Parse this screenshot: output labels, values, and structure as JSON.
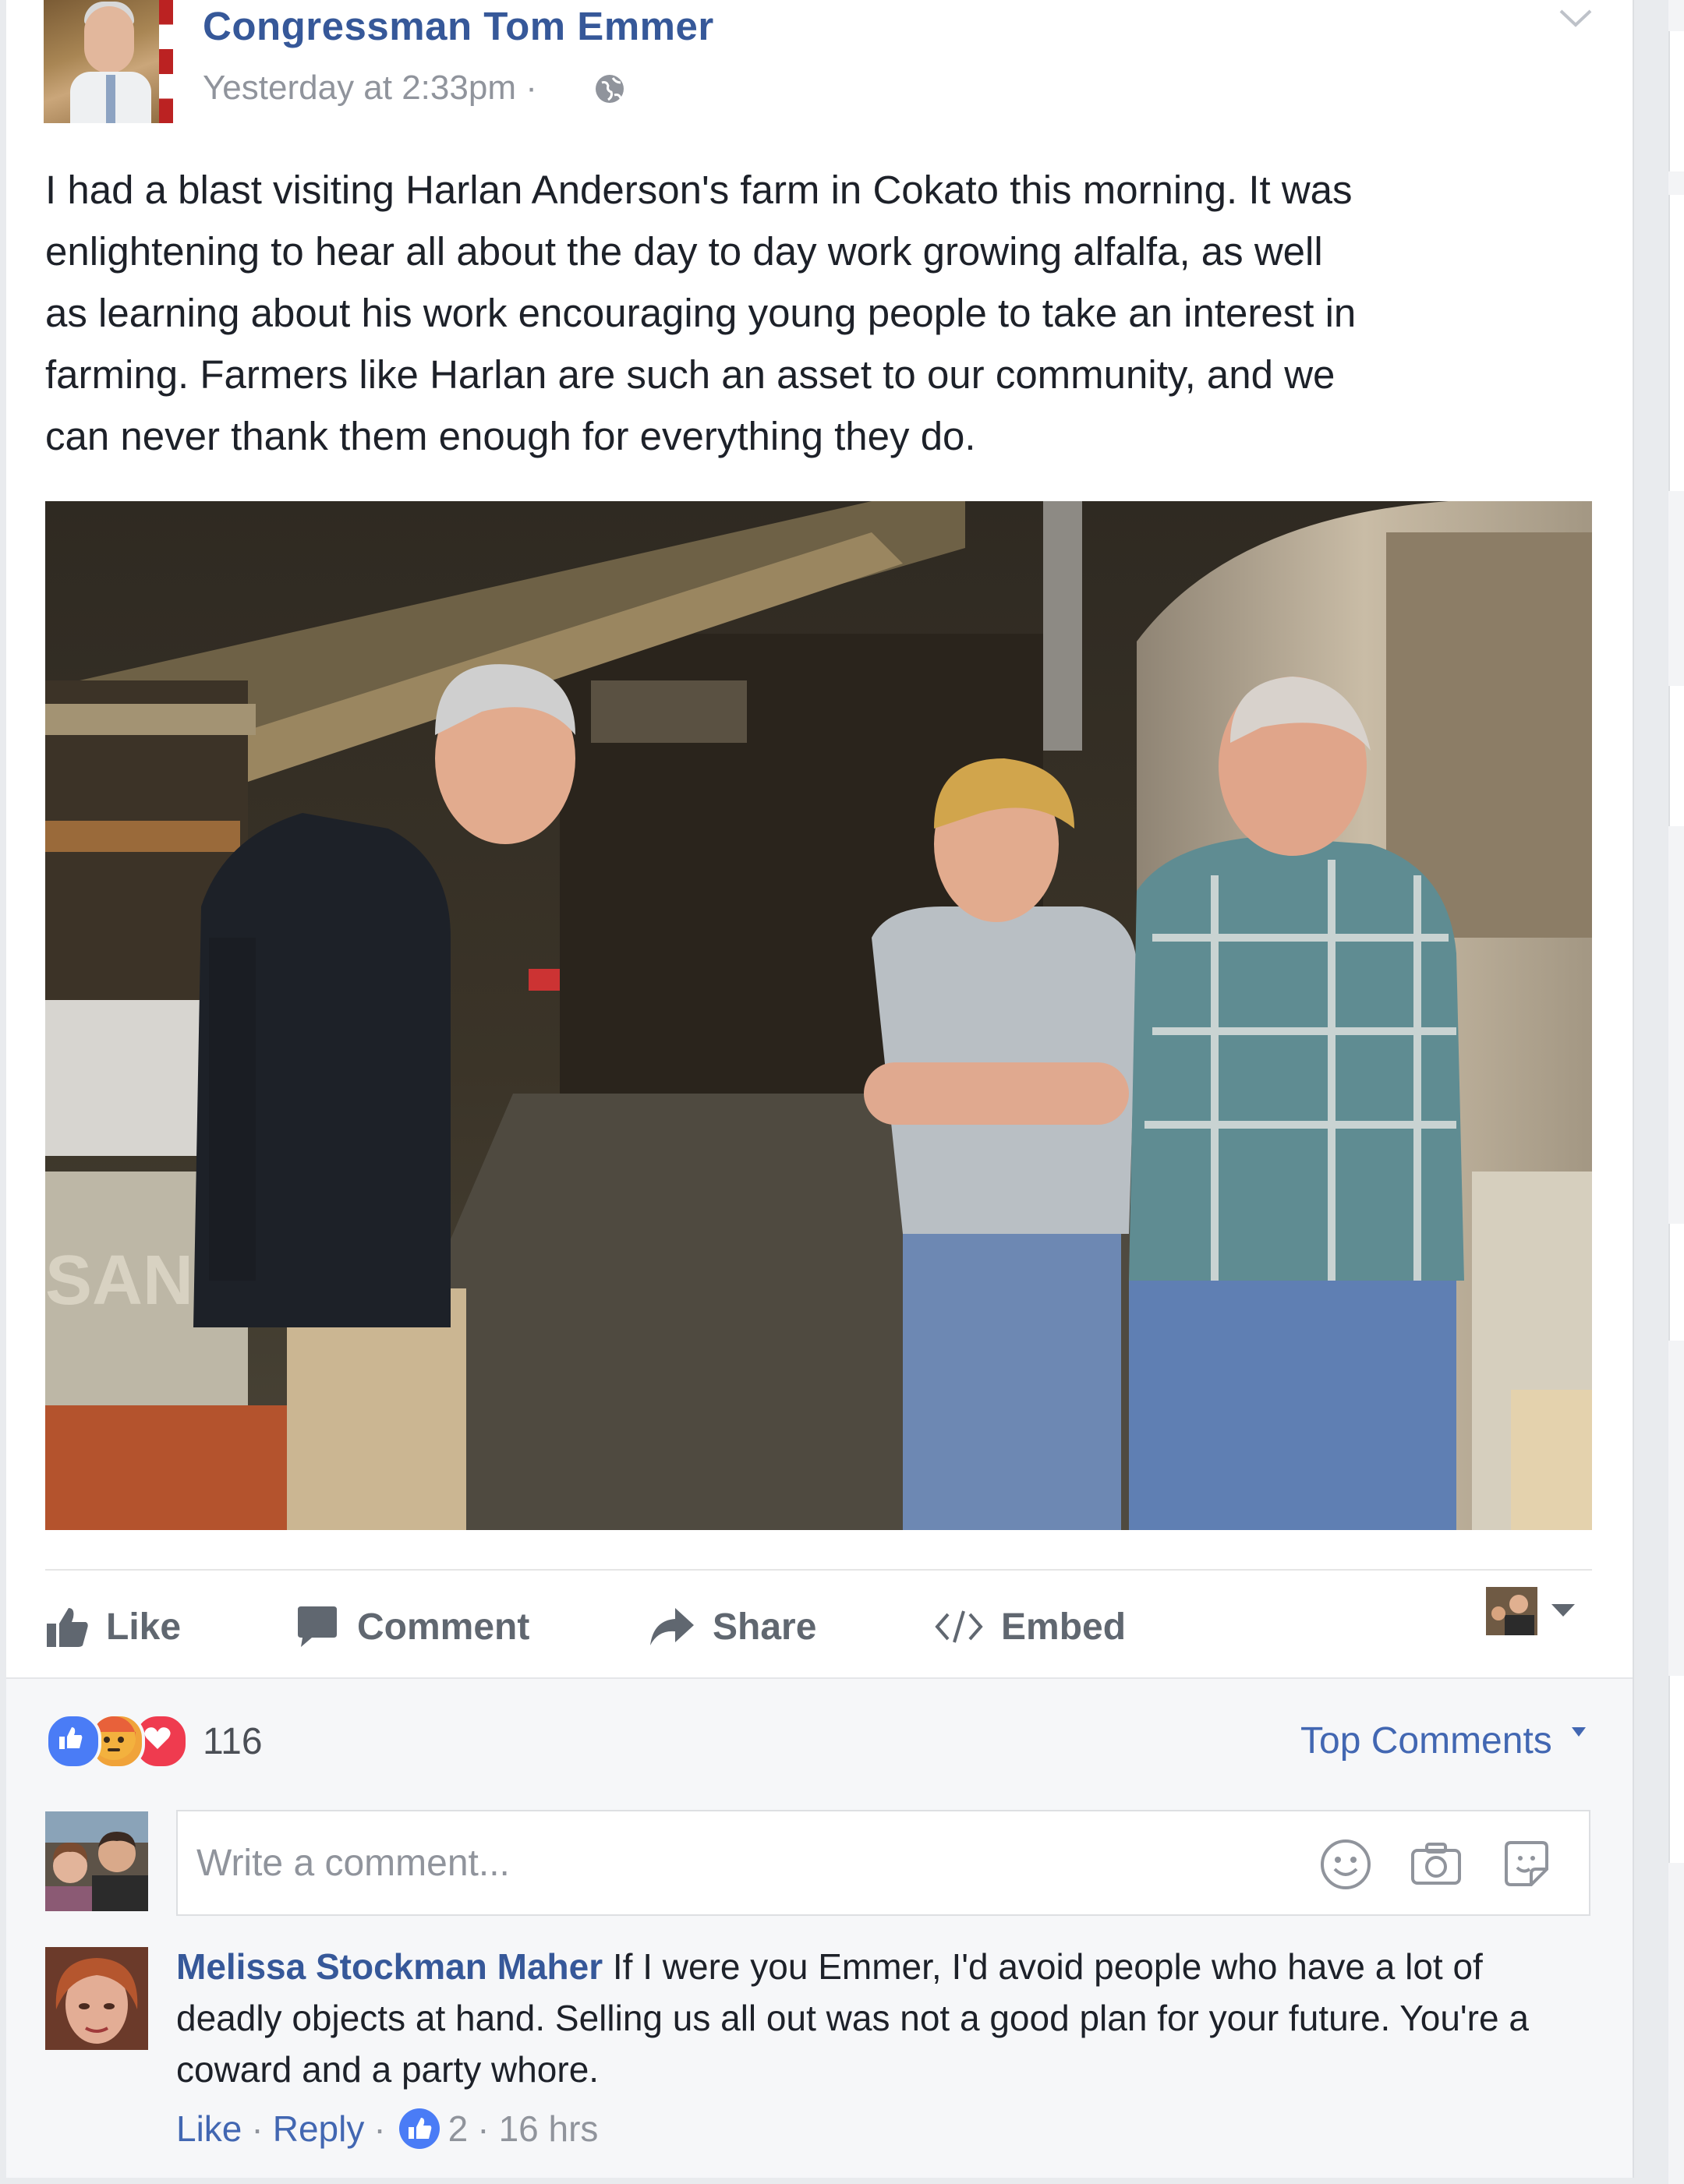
{
  "post": {
    "page_name": "Congressman Tom Emmer",
    "timestamp": "Yesterday at 2:33pm",
    "separator": "·",
    "body": "I had a blast visiting Harlan Anderson's farm in Cokato this morning. It was\nenlightening to hear all about the day to day work growing alfalfa, as well\nas learning about his work encouraging young people to take an interest in\nfarming. Farmers like Harlan are such an asset to our community, and we\ncan never thank them enough for everything they do.",
    "photo_machine_text": "SAN"
  },
  "actions": {
    "like": "Like",
    "comment": "Comment",
    "share": "Share",
    "embed": "Embed"
  },
  "reactions": {
    "count": "116",
    "types": [
      "like",
      "angry",
      "love"
    ],
    "sort_label": "Top Comments"
  },
  "composer": {
    "placeholder": "Write a comment..."
  },
  "comment": {
    "author": "Melissa Stockman Maher",
    "text": "If I were you Emmer, I'd avoid people who have a lot of deadly objects at hand. Selling us all out was not a good plan for your future. You're a coward and a party whore.",
    "like_label": "Like",
    "reply_label": "Reply",
    "dot": "·",
    "like_count": "2",
    "age": "16 hrs"
  },
  "colors": {
    "link_blue": "#365899",
    "accent_blue": "#4267b2",
    "muted": "#90949c",
    "like_reaction": "#4a7cf6",
    "angry_reaction": "#f0a33a",
    "love_reaction": "#ef3b4f"
  },
  "icons": [
    "globe-icon",
    "chevron-down-icon",
    "like-icon",
    "comment-icon",
    "share-icon",
    "embed-icon",
    "smiley-icon",
    "camera-icon",
    "sticker-icon"
  ]
}
